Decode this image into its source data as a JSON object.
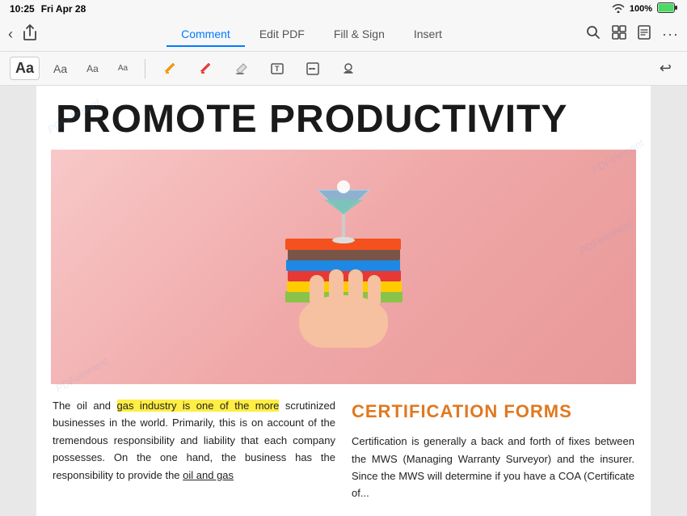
{
  "statusBar": {
    "time": "10:25",
    "day": "Fri Apr 28",
    "battery": "100%",
    "wifi": "wifi"
  },
  "navBar": {
    "tabs": [
      {
        "label": "Comment",
        "active": true
      },
      {
        "label": "Edit PDF",
        "active": false
      },
      {
        "label": "Fill & Sign",
        "active": false
      },
      {
        "label": "Insert",
        "active": false
      }
    ],
    "dots": "···"
  },
  "toolbar": {
    "items": [
      {
        "id": "aa-large",
        "label": "Aa",
        "size": "large",
        "highlighted": true
      },
      {
        "id": "aa-medium",
        "label": "Aa",
        "size": "medium"
      },
      {
        "id": "aa-small",
        "label": "Aa",
        "size": "small"
      },
      {
        "id": "aa-xs",
        "label": "Aa",
        "size": "xs"
      },
      {
        "id": "pen-orange",
        "label": "✏",
        "size": "medium"
      },
      {
        "id": "pen-red",
        "label": "✏",
        "size": "medium"
      },
      {
        "id": "eraser",
        "label": "◻",
        "size": "medium"
      },
      {
        "id": "text-box",
        "label": "T",
        "size": "medium"
      },
      {
        "id": "dash",
        "label": "—",
        "size": "medium"
      },
      {
        "id": "stamp",
        "label": "⬛",
        "size": "medium"
      }
    ],
    "undoLabel": "↩"
  },
  "document": {
    "title": "PROMOTE PRODUCTIVITY",
    "watermarks": [
      "PDFelement",
      "PDFelement",
      "PDFelement",
      "PDFelement",
      "PDFelement"
    ],
    "leftColumn": {
      "text1": "The oil and ",
      "highlighted": "gas industry is one of the more",
      "text2": " scrutinized businesses in the world. Primarily, this is on account of the tremendous responsibility and liability that each company possesses. On the one hand, the business has the responsibility to provide the ",
      "underlined": "oil and gas"
    },
    "rightColumn": {
      "title": "CERTIFICATION FORMS",
      "body": "Certification is generally a back and forth of fixes between the MWS (Managing Warranty Surveyor) and the insurer. Since the MWS will determine if you have a COA (Certificate of..."
    }
  }
}
